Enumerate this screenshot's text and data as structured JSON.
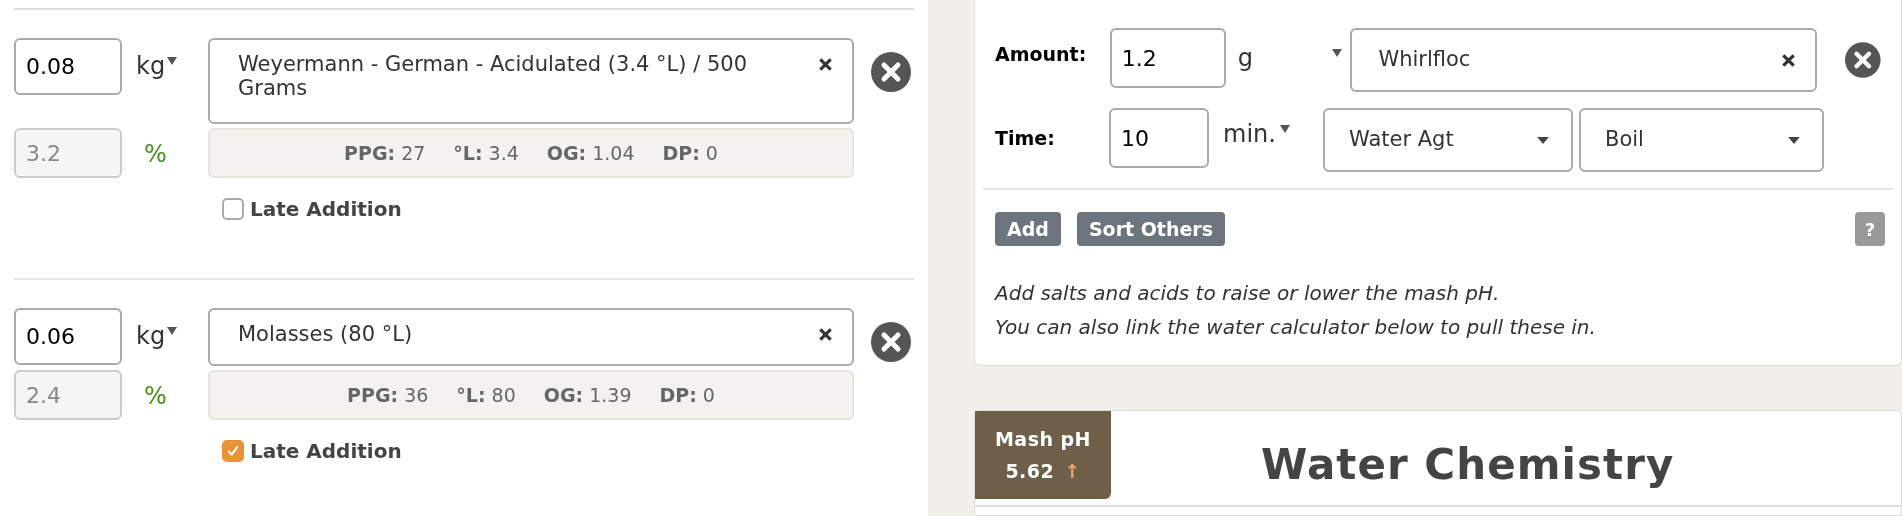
{
  "fermentables": [
    {
      "amount": "0.08",
      "unit": "kg",
      "name": "Weyermann - German - Acidulated (3.4 °L) / 500 Grams",
      "percent": "3.2",
      "percent_sign": "%",
      "stats": [
        {
          "label": "PPG:",
          "value": "27"
        },
        {
          "label": "°L:",
          "value": "3.4"
        },
        {
          "label": "OG:",
          "value": "1.04"
        },
        {
          "label": "DP:",
          "value": "0"
        }
      ],
      "late_addition": {
        "label": "Late Addition",
        "checked": false
      }
    },
    {
      "amount": "0.06",
      "unit": "kg",
      "name": "Molasses (80 °L)",
      "percent": "2.4",
      "percent_sign": "%",
      "stats": [
        {
          "label": "PPG:",
          "value": "36"
        },
        {
          "label": "°L:",
          "value": "80"
        },
        {
          "label": "OG:",
          "value": "1.39"
        },
        {
          "label": "DP:",
          "value": "0"
        }
      ],
      "late_addition": {
        "label": "Late Addition",
        "checked": true
      }
    }
  ],
  "misc": {
    "amount_label": "Amount:",
    "amount": "1.2",
    "unit": "g",
    "name": "Whirlfloc",
    "time_label": "Time:",
    "time": "10",
    "time_unit": "min.",
    "use": "Water Agt",
    "stage": "Boil"
  },
  "buttons": [
    "Add",
    "Sort Others"
  ],
  "help": "?",
  "note": [
    "Add salts and acids to raise or lower the mash pH.",
    "You can also link the water calculator below to pull these in."
  ],
  "water": {
    "badge_label": "Mash pH",
    "badge_value": "5.62",
    "badge_arrow": "↑",
    "title": "Water Chemistry"
  }
}
